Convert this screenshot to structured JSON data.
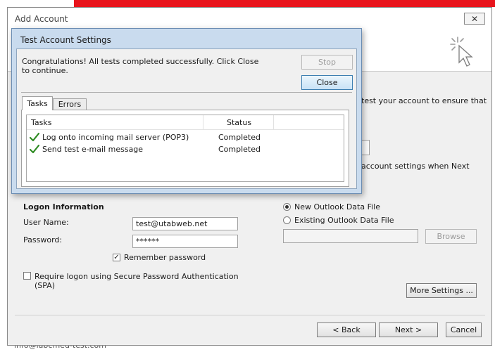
{
  "window": {
    "title": "Add Account",
    "close_glyph": "✕"
  },
  "background": {
    "bottom_text": "info@labcmed-test.com"
  },
  "right_panel": {
    "text1": "test your account to ensure that",
    "text2": "account settings when Next"
  },
  "logon": {
    "section_title": "Logon Information",
    "user_name_label": "User Name:",
    "user_name_value": "test@utabweb.net",
    "password_label": "Password:",
    "password_value": "******",
    "remember_label": "Remember password",
    "remember_checked": "✓",
    "spa_label_line1": "Require logon using Secure Password Authentication",
    "spa_label_line2": "(SPA)"
  },
  "data_file": {
    "new_label": "New Outlook Data File",
    "existing_label": "Existing Outlook Data File",
    "path_value": "",
    "browse_label": "Browse"
  },
  "buttons": {
    "more_settings": "More Settings ...",
    "back": "< Back",
    "next": "Next >",
    "cancel": "Cancel"
  },
  "test_dialog": {
    "title": "Test Account Settings",
    "message": "Congratulations! All tests completed successfully. Click Close to continue.",
    "stop_label": "Stop",
    "close_label": "Close",
    "tabs": [
      "Tasks",
      "Errors"
    ],
    "columns": [
      "Tasks",
      "Status"
    ],
    "rows": [
      {
        "task": "Log onto incoming mail server (POP3)",
        "status": "Completed"
      },
      {
        "task": "Send test e-mail message",
        "status": "Completed"
      }
    ]
  },
  "colors": {
    "check_green": "#2e8b22",
    "top_bar_red": "#e8141c",
    "dialog_frame": "#c9dbee"
  }
}
